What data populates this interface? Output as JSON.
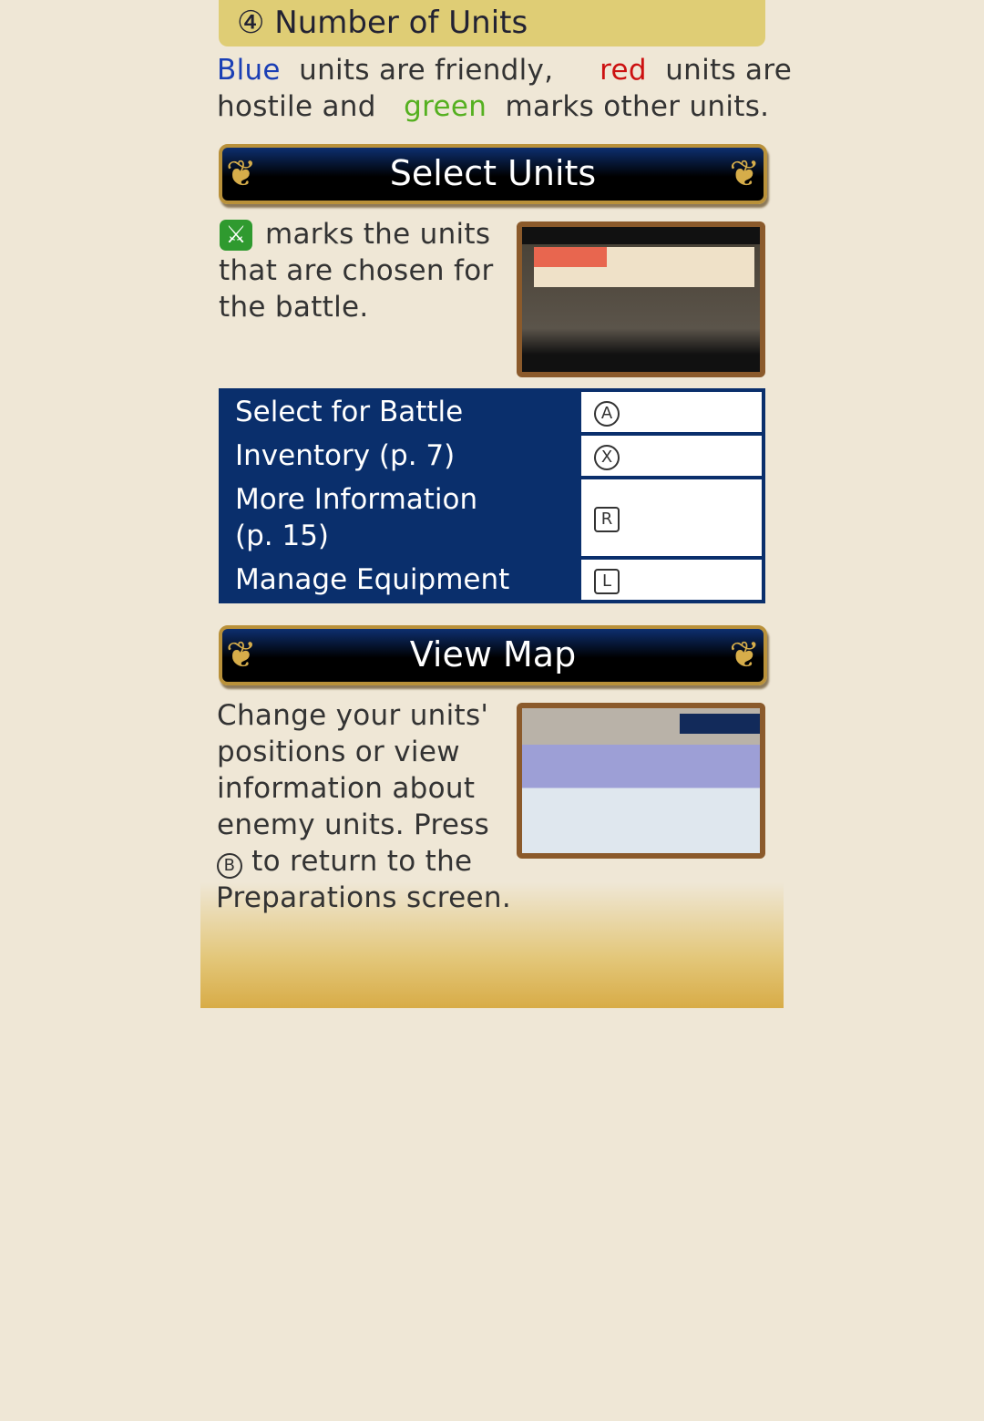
{
  "number_of_units": {
    "title": "④ Number of Units",
    "w_blue": "Blue",
    "t1": "units are friendly,",
    "w_red": "red",
    "t2": "units are",
    "t3": "hostile and",
    "w_green": "green",
    "t4": "marks other units.",
    "colors": {
      "blue": "#1a3fb5",
      "red": "#cc1111",
      "green": "#55b020"
    }
  },
  "select_units": {
    "title": "Select Units",
    "line1": "marks the units",
    "line2": "that are chosen for",
    "line3": "the battle.",
    "icon": "green-sword-check-icon",
    "controls": [
      {
        "label": "Select for Battle",
        "key": "A"
      },
      {
        "label": "Inventory (p. 7)",
        "key": "X"
      },
      {
        "label": "More Information",
        "label2": "(p. 15)",
        "key": "R"
      },
      {
        "label": "Manage Equipment",
        "key": "L"
      }
    ]
  },
  "view_map": {
    "title": "View Map",
    "lines": [
      "Change your units'",
      "positions or view",
      "information about",
      "enemy units. Press"
    ],
    "key": "B",
    "line5": "to return to the",
    "line6": "Preparations screen."
  }
}
